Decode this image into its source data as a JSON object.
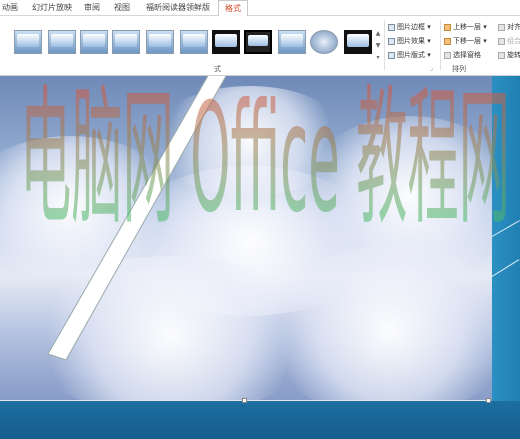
{
  "ribbon": {
    "tabs": [
      {
        "label": "动画"
      },
      {
        "label": "幻灯片放映"
      },
      {
        "label": "审阅"
      },
      {
        "label": "视图"
      },
      {
        "label": "福昕阅读器领鲜版"
      },
      {
        "label": "格式"
      }
    ],
    "active_tab": "格式",
    "picture_styles_group_label": "式",
    "picture_styles": [
      "picture-style-1",
      "picture-style-2",
      "picture-style-3",
      "picture-style-4",
      "picture-style-5",
      "picture-style-6",
      "picture-style-7",
      "picture-style-8",
      "picture-style-9",
      "picture-style-10",
      "picture-style-11"
    ],
    "picture_commands": {
      "border": "图片边框",
      "effects": "图片效果",
      "layout": "图片版式"
    },
    "arrange": {
      "bring_forward": "上移一层",
      "send_backward": "下移一层",
      "selection_pane": "选择窗格",
      "align": "对齐",
      "group": "组合",
      "rotate": "旋转",
      "group_label": "排列"
    }
  },
  "watermark": {
    "text": "电脑网 Office 教程网",
    "color_top": "#e74c3c",
    "color_bottom": "#2ecc71"
  },
  "colors": {
    "accent_tab": "#d24726",
    "slide_band": "#1d6fa2"
  }
}
